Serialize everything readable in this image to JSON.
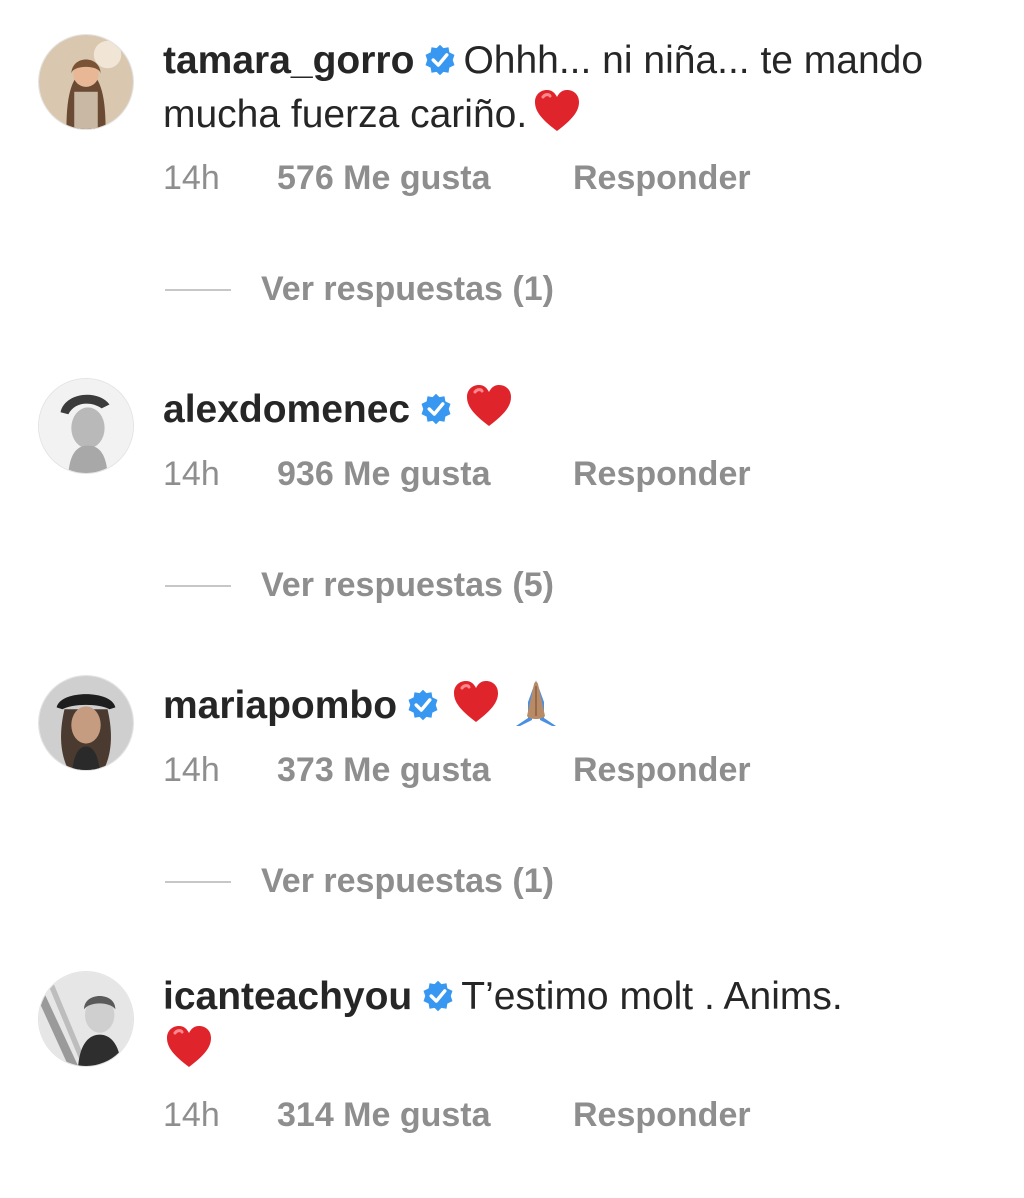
{
  "comments": [
    {
      "username": "tamara_gorro",
      "text": "Ohhh... ni niña... te mando mucha fuerza cariño.",
      "emojis": [
        "red-heart"
      ],
      "time": "14h",
      "likes": "576 Me gusta",
      "reply": "Responder",
      "view_replies": "Ver respuestas (1)"
    },
    {
      "username": "alexdomenec",
      "text": "",
      "emojis": [
        "red-heart"
      ],
      "time": "14h",
      "likes": "936 Me gusta",
      "reply": "Responder",
      "view_replies": "Ver respuestas (5)"
    },
    {
      "username": "mariapombo",
      "text": "",
      "emojis": [
        "red-heart",
        "folded-hands"
      ],
      "time": "14h",
      "likes": "373 Me gusta",
      "reply": "Responder",
      "view_replies": "Ver respuestas (1)"
    },
    {
      "username": "icanteachyou",
      "text": "T’estimo molt . Anims.",
      "emojis": [
        "red-heart"
      ],
      "time": "14h",
      "likes": "314 Me gusta",
      "reply": "Responder"
    }
  ],
  "colors": {
    "verified": "#3897f0",
    "meta_text": "#8e8e8e",
    "heart": "#e0242b"
  }
}
